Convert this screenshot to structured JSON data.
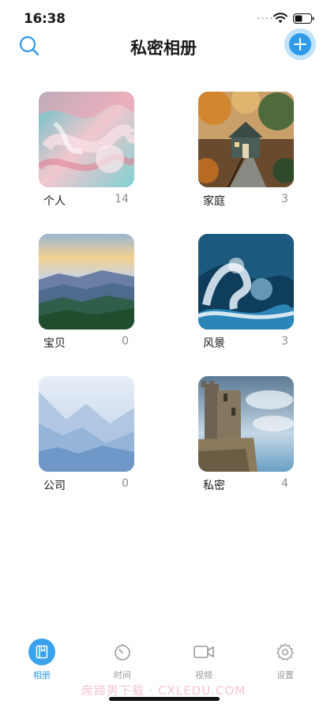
{
  "status": {
    "time": "16:38",
    "signal_dots": "····"
  },
  "header": {
    "title": "私密相册"
  },
  "albums": [
    {
      "name": "个人",
      "count": "14",
      "theme": "pink-teal swirl"
    },
    {
      "name": "家庭",
      "count": "3",
      "theme": "cabin in autumn forest"
    },
    {
      "name": "宝贝",
      "count": "0",
      "theme": "mountain sunrise"
    },
    {
      "name": "风景",
      "count": "3",
      "theme": "ocean wave"
    },
    {
      "name": "公司",
      "count": "0",
      "theme": "misty blue hills"
    },
    {
      "name": "私密",
      "count": "4",
      "theme": "castle ruin"
    }
  ],
  "tabs": [
    {
      "label": "相册",
      "icon": "album-book-icon",
      "active": true
    },
    {
      "label": "时间",
      "icon": "timer-icon",
      "active": false
    },
    {
      "label": "视频",
      "icon": "video-camera-icon",
      "active": false
    },
    {
      "label": "设置",
      "icon": "gear-icon",
      "active": false
    }
  ],
  "watermark": "席蹄男下载 · CXLEDU.COM",
  "colors": {
    "accent": "#2f9ae9",
    "accent_light": "#bfe2f8",
    "muted_text": "#8a8a8a"
  }
}
